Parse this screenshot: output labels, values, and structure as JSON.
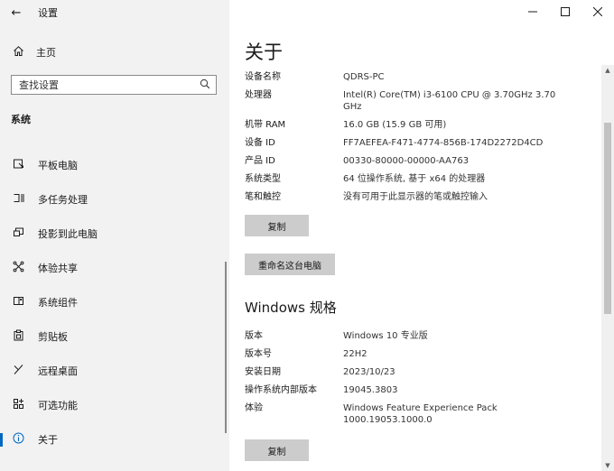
{
  "window": {
    "title": "设置",
    "back_icon": "←",
    "minimize_icon": "—",
    "maximize_icon": "☐",
    "close_icon": "✕"
  },
  "sidebar": {
    "home_label": "主页",
    "search_placeholder": "查找设置",
    "section_title": "系统",
    "items": [
      {
        "label": "平板电脑",
        "icon": "tablet-icon"
      },
      {
        "label": "多任务处理",
        "icon": "multitask-icon"
      },
      {
        "label": "投影到此电脑",
        "icon": "project-icon"
      },
      {
        "label": "体验共享",
        "icon": "shared-experience-icon"
      },
      {
        "label": "系统组件",
        "icon": "components-icon"
      },
      {
        "label": "剪贴板",
        "icon": "clipboard-icon"
      },
      {
        "label": "远程桌面",
        "icon": "remote-desktop-icon"
      },
      {
        "label": "可选功能",
        "icon": "optional-features-icon"
      },
      {
        "label": "关于",
        "icon": "info-icon",
        "active": true
      }
    ]
  },
  "content": {
    "title": "关于",
    "device_specs": [
      {
        "key": "设备名称",
        "value": "QDRS-PC"
      },
      {
        "key": "处理器",
        "value": "Intel(R) Core(TM) i3-6100 CPU @ 3.70GHz   3.70 GHz"
      },
      {
        "key": "机带 RAM",
        "value": "16.0 GB (15.9 GB 可用)"
      },
      {
        "key": "设备 ID",
        "value": "FF7AEFEA-F471-4774-856B-174D2272D4CD"
      },
      {
        "key": "产品 ID",
        "value": "00330-80000-00000-AA763"
      },
      {
        "key": "系统类型",
        "value": "64 位操作系统, 基于 x64 的处理器"
      },
      {
        "key": "笔和触控",
        "value": "没有可用于此显示器的笔或触控输入"
      }
    ],
    "copy_label": "复制",
    "rename_label": "重命名这台电脑",
    "windows_section_title": "Windows 规格",
    "windows_specs": [
      {
        "key": "版本",
        "value": "Windows 10 专业版"
      },
      {
        "key": "版本号",
        "value": "22H2"
      },
      {
        "key": "安装日期",
        "value": "2023/10/23"
      },
      {
        "key": "操作系统内部版本",
        "value": "19045.3803"
      },
      {
        "key": "体验",
        "value": "Windows Feature Experience Pack 1000.19053.1000.0"
      }
    ],
    "copy2_label": "复制"
  }
}
